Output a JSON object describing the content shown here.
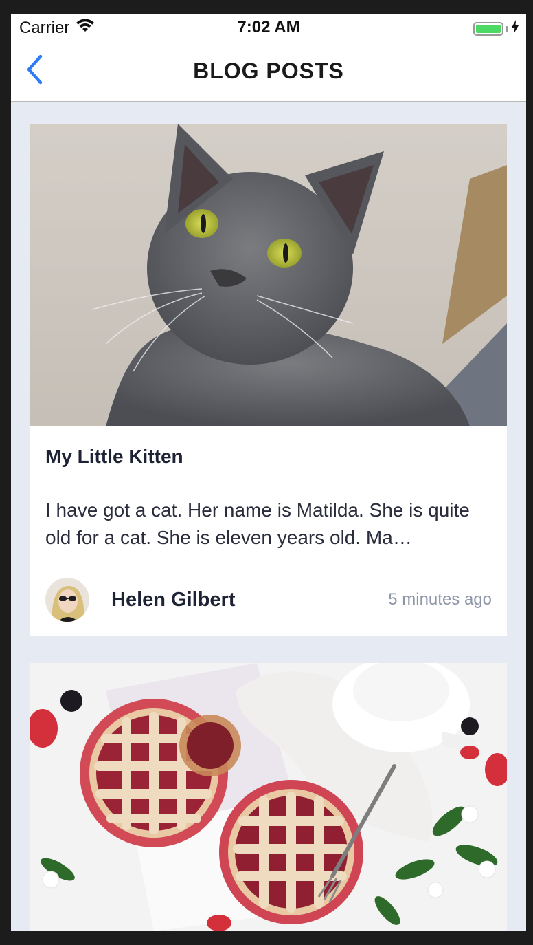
{
  "status_bar": {
    "carrier": "Carrier",
    "time": "7:02 AM",
    "battery_level": 1.0,
    "battery_color": "#4cd964"
  },
  "nav": {
    "title": "BLOG POSTS",
    "back_icon": "chevron-left-icon",
    "accent": "#2f7cf6"
  },
  "posts": [
    {
      "image": "gray-cat-photo",
      "title": "My Little Kitten",
      "excerpt": "I have got a cat. Her name is Matilda. She is quite old for a cat. She is eleven years old. Ma…",
      "author": "Helen Gilbert",
      "time_ago": "5 minutes ago"
    },
    {
      "image": "berry-pies-photo"
    }
  ],
  "colors": {
    "background": "#e6ebf3",
    "card": "#ffffff",
    "title_text": "#1e2235",
    "muted_text": "#8e96a8"
  }
}
